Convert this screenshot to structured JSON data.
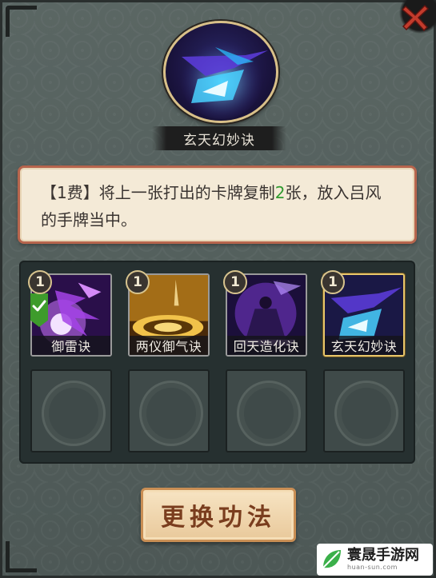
{
  "skill": {
    "name": "玄天幻妙诀",
    "portrait_icon": "blue-crane-wing-icon"
  },
  "description": {
    "prefix": "【1费】将上一张打出的卡牌复制",
    "highlight": "2",
    "suffix": "张，放入吕风的手牌当中。",
    "highlight_color": "#2f9a2f"
  },
  "cards": [
    {
      "name": "御雷诀",
      "cost": "1",
      "icon": "purple-lightning-icon",
      "equipped": true,
      "check_icon": "checkmark-icon"
    },
    {
      "name": "两仪御气诀",
      "cost": "1",
      "icon": "golden-yin-yang-icon",
      "equipped": false
    },
    {
      "name": "回天造化诀",
      "cost": "1",
      "icon": "meditating-figure-icon",
      "equipped": false
    },
    {
      "name": "玄天幻妙诀",
      "cost": "1",
      "icon": "blue-crane-wing-icon",
      "equipped": false,
      "selected": true
    }
  ],
  "empty_slots": 4,
  "buttons": {
    "swap_label": "更换功法",
    "close_icon": "close-x-icon"
  },
  "watermark": {
    "main": "寰晟手游网",
    "sub": "huan-sun.com"
  },
  "colors": {
    "accent_red": "#b7654d",
    "gold_border": "#e8c66a",
    "panel_bg": "#4f5b58"
  }
}
